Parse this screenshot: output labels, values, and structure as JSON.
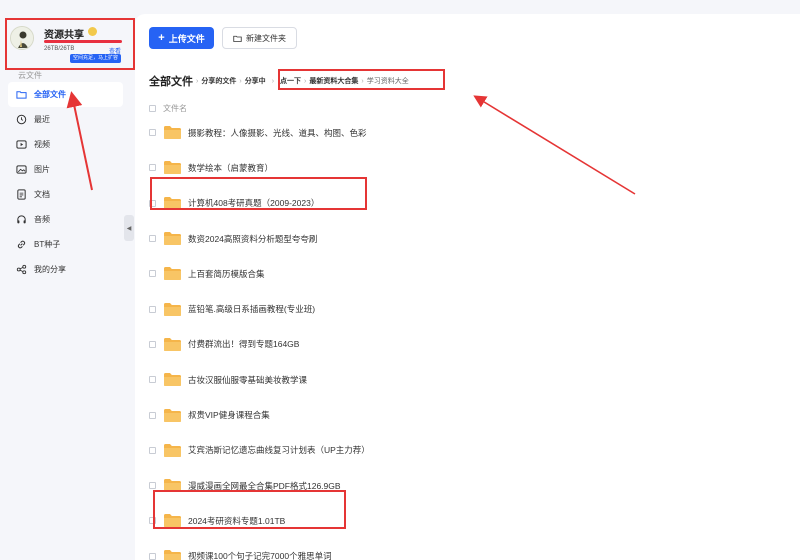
{
  "profile": {
    "name": "资源共享",
    "quota": "26TB/26TB",
    "quota_fraction": 1.0,
    "view_link": "查看",
    "expand_button": "空间充足，马上扩容"
  },
  "sidebar": {
    "section_label": "云文件",
    "items": [
      {
        "label": "全部文件",
        "icon": "folder-icon",
        "active": true
      },
      {
        "label": "最近",
        "icon": "clock-icon",
        "active": false
      },
      {
        "label": "视频",
        "icon": "video-icon",
        "active": false
      },
      {
        "label": "图片",
        "icon": "image-icon",
        "active": false
      },
      {
        "label": "文档",
        "icon": "document-icon",
        "active": false
      },
      {
        "label": "音频",
        "icon": "headphones-icon",
        "active": false
      },
      {
        "label": "BT种子",
        "icon": "link-icon",
        "active": false
      },
      {
        "label": "我的分享",
        "icon": "share-icon",
        "active": false
      }
    ]
  },
  "toolbar": {
    "upload_label": "上传文件",
    "new_folder_label": "新建文件夹"
  },
  "breadcrumb": {
    "root": "全部文件",
    "items": [
      "分享的文件",
      "分享中",
      "点一下",
      "最新资料大合集",
      "学习资料大全"
    ]
  },
  "list": {
    "header": "文件名",
    "files": [
      "摄影教程：人像摄影、光线、道具、构图、色彩",
      "数学绘本（启蒙教育）",
      "计算机408考研真题（2009-2023）",
      "数资2024高照资料分析题型夸夸刷",
      "上百套简历模版合集",
      "蓝铅笔.高级日系插画教程(专业班)",
      "付费群流出！得到专题164GB",
      "古妆汉服仙服零基础美妆教学课",
      "叔贵VIP健身课程合集",
      "艾宾浩斯记忆遗忘曲线复习计划表（UP主力荐）",
      "漫威漫画全网最全合集PDF格式126.9GB",
      "2024考研资料专题1.01TB",
      "视频课100个句子记完7000个雅思单词"
    ]
  },
  "colors": {
    "accent": "#2663f4",
    "highlight": "#e53535",
    "folder": "#f5b54a"
  }
}
